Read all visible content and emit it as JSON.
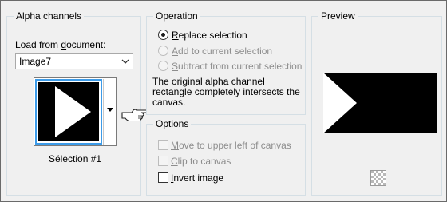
{
  "alpha": {
    "title": "Alpha channels",
    "load_label_pre": "Load from ",
    "load_label_u": "d",
    "load_label_post": "ocument:",
    "document_value": "Image7",
    "selection_name": "Sélection #1"
  },
  "operation": {
    "title": "Operation",
    "replace": {
      "u": "R",
      "rest": "eplace selection",
      "checked": true,
      "enabled": true
    },
    "add": {
      "u": "A",
      "rest": "dd to current selection",
      "enabled": false
    },
    "subtract": {
      "u": "S",
      "rest": "ubtract from current selection",
      "enabled": false
    },
    "info_text": "The original alpha channel rectangle completely intersects the canvas."
  },
  "options": {
    "title": "Options",
    "move": {
      "u": "M",
      "rest": "ove to upper left of canvas",
      "enabled": false,
      "checked": false
    },
    "clip": {
      "u": "C",
      "rest": "lip to canvas",
      "enabled": false,
      "checked": false
    },
    "invert": {
      "u": "I",
      "rest": "nvert image",
      "enabled": true,
      "checked": false
    }
  },
  "preview": {
    "title": "Preview"
  },
  "icons": {
    "combo_arrow": "chevron-down-icon",
    "thumb_dropdown": "triangle-down-icon",
    "pointer": "pointing-hand-icon",
    "checker": "transparency-checker-icon"
  },
  "colors": {
    "selection_border": "#3c9be8",
    "disabled_text": "#8d8d8d"
  }
}
